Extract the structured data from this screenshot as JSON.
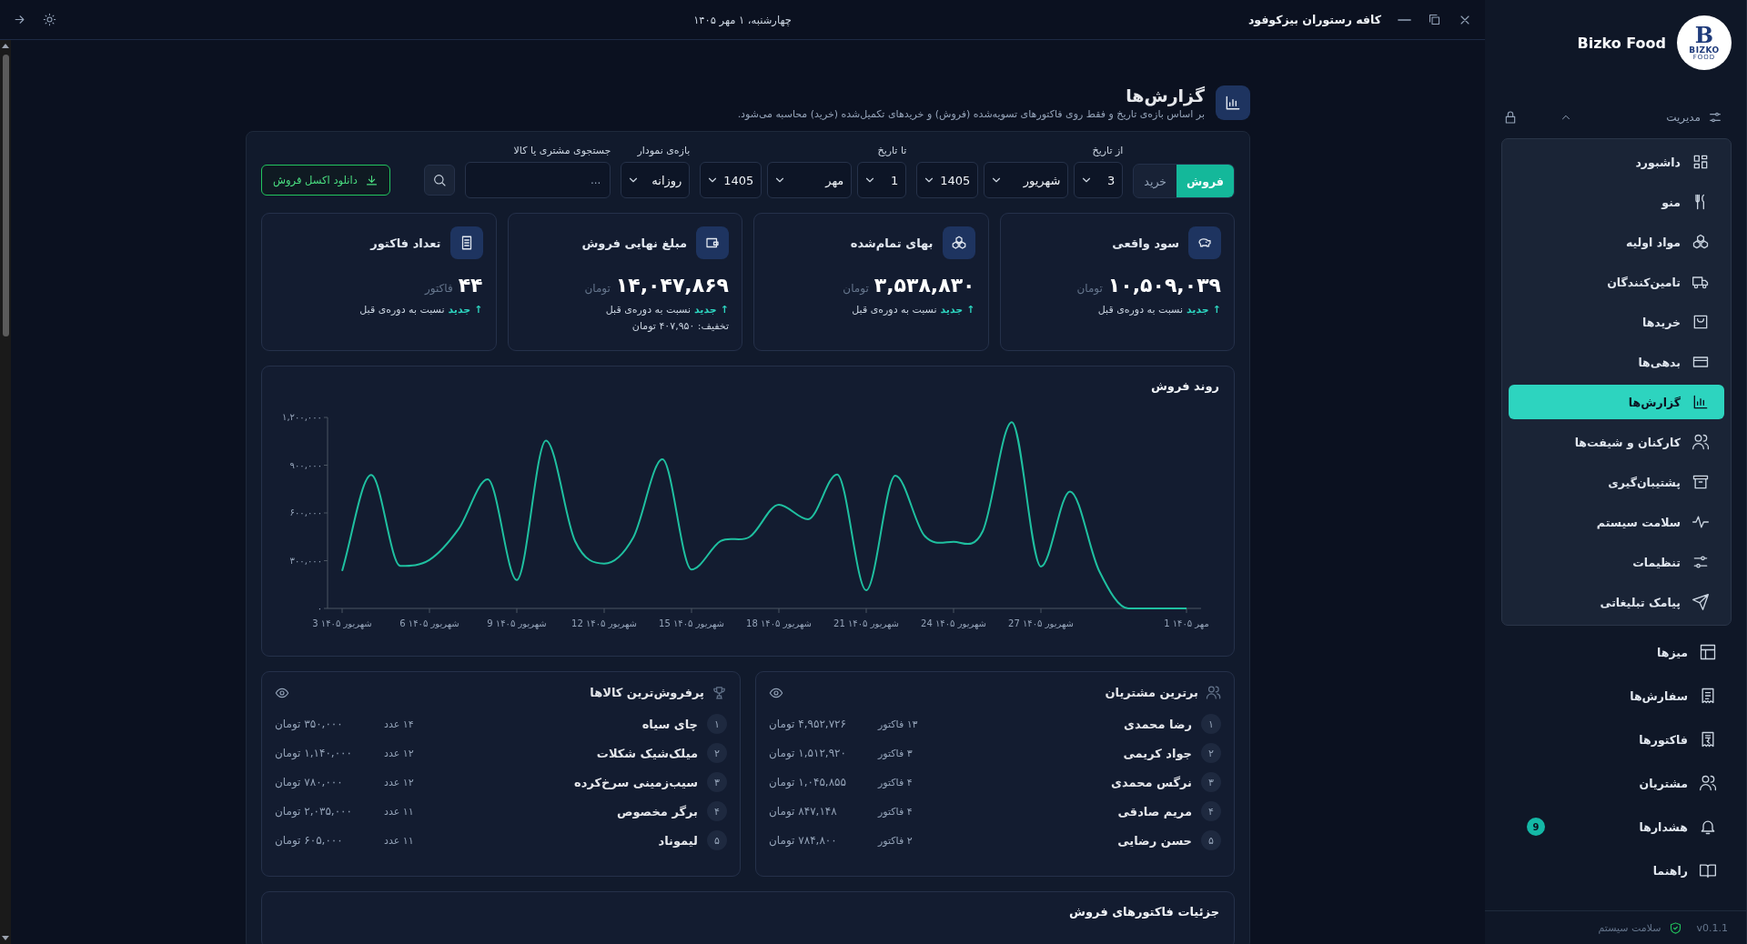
{
  "top_bar": {
    "date": "چهارشنبه، ۱ مهر ۱۴۰۵",
    "app_title": "کافه رستوران بیزکوفود"
  },
  "header": {
    "title": "گزارش‌ها",
    "subtitle": "بر اساس بازه‌ی تاریخ و فقط روی فاکتورهای تسویه‌شده (فروش) و خریدهای تکمیل‌شده (خرید) محاسبه می‌شود."
  },
  "filters": {
    "mode_toggle": [
      {
        "label": "فروش",
        "selected": true
      },
      {
        "label": "خرید",
        "selected": false
      }
    ],
    "groups": [
      {
        "label": "از تاریخ",
        "selects": [
          "3",
          "شهریور",
          "1405"
        ]
      },
      {
        "label": "تا تاریخ",
        "selects": [
          "1",
          "مهر",
          "1405"
        ]
      },
      {
        "label": "بازه‌ی نمودار",
        "selects": [
          "روزانه"
        ]
      }
    ],
    "search": {
      "label": "جستجوی مشتری یا کالا",
      "placeholder": "..."
    },
    "export_button": "دانلود اکسل فروش"
  },
  "stat_cards": [
    {
      "title": "سود واقعی",
      "value": "۱۰,۵۰۹,۰۳۹",
      "unit": "تومان",
      "trend": {
        "arrow": "↑",
        "badge": "جدید",
        "text": "نسبت به دوره‌ی قبل"
      }
    },
    {
      "title": "بهای تمام‌شده",
      "value": "۳,۵۳۸,۸۳۰",
      "unit": "تومان",
      "trend": {
        "arrow": "↑",
        "badge": "جدید",
        "text": "نسبت به دوره‌ی قبل"
      }
    },
    {
      "title": "مبلغ نهایی فروش",
      "value": "۱۴,۰۴۷,۸۶۹",
      "unit": "تومان",
      "trend": {
        "arrow": "↑",
        "badge": "جدید",
        "text": "نسبت به دوره‌ی قبل"
      },
      "note": "تخفیف: ۴۰۷,۹۵۰ تومان"
    },
    {
      "title": "تعداد فاکتور",
      "value": "۴۴",
      "unit": "فاکتور",
      "trend": {
        "arrow": "↑",
        "badge": "جدید",
        "text": "نسبت به دوره‌ی قبل"
      }
    }
  ],
  "sales_chart": {
    "title": "روند فروش",
    "chart_data": {
      "type": "line",
      "categories": [
        "3 شهریور ۱۴۰۵",
        null,
        null,
        "6 شهریور ۱۴۰۵",
        null,
        null,
        "9 شهریور ۱۴۰۵",
        null,
        null,
        "12 شهریور ۱۴۰۵",
        null,
        null,
        "15 شهریور ۱۴۰۵",
        null,
        null,
        "18 شهریور ۱۴۰۵",
        null,
        null,
        "21 شهریور ۱۴۰۵",
        null,
        null,
        "24 شهریور ۱۴۰۵",
        null,
        null,
        "27 شهریور ۱۴۰۵",
        null,
        null,
        null,
        null,
        "1 مهر ۱۴۰۵"
      ],
      "series": [
        {
          "color": "#1fc0a0",
          "values": [
            236000,
            838000,
            267000,
            305000,
            499000,
            811000,
            179000,
            1055000,
            423000,
            282000,
            446000,
            937000,
            244000,
            423000,
            450000,
            651000,
            560000,
            842000,
            114000,
            834000,
            457000,
            419000,
            484000,
            1170000,
            263000,
            735000,
            236000,
            0,
            0,
            0
          ]
        }
      ],
      "ylim": [
        0,
        1200000
      ],
      "yticks": [
        {
          "value": 0,
          "label": "۰"
        },
        {
          "value": 300000,
          "label": "۳۰۰,۰۰۰"
        },
        {
          "value": 600000,
          "label": "۶۰۰,۰۰۰"
        },
        {
          "value": 900000,
          "label": "۹۰۰,۰۰۰"
        },
        {
          "value": 1200000,
          "label": "۱,۲۰۰,۰۰۰"
        }
      ]
    }
  },
  "top_customers": {
    "title": "برترین مشتریان",
    "rows": [
      {
        "rank": "۱",
        "name": "رضا محمدی",
        "count": "۱۳ فاکتور",
        "amount": "۴,۹۵۲,۷۲۶ تومان"
      },
      {
        "rank": "۲",
        "name": "جواد کریمی",
        "count": "۳ فاکتور",
        "amount": "۱,۵۱۲,۹۲۰ تومان"
      },
      {
        "rank": "۳",
        "name": "نرگس محمدی",
        "count": "۴ فاکتور",
        "amount": "۱,۰۴۵,۸۵۵ تومان"
      },
      {
        "rank": "۴",
        "name": "مریم صادقی",
        "count": "۴ فاکتور",
        "amount": "۸۴۷,۱۴۸ تومان"
      },
      {
        "rank": "۵",
        "name": "حسن رضایی",
        "count": "۲ فاکتور",
        "amount": "۷۸۴,۸۰۰ تومان"
      }
    ]
  },
  "top_products": {
    "title": "پرفروش‌ترین کالاها",
    "rows": [
      {
        "rank": "۱",
        "name": "چای سیاه",
        "count": "۱۴ عدد",
        "amount": "۳۵۰,۰۰۰ تومان"
      },
      {
        "rank": "۲",
        "name": "میلک‌شیک شکلات",
        "count": "۱۲ عدد",
        "amount": "۱,۱۴۰,۰۰۰ تومان"
      },
      {
        "rank": "۳",
        "name": "سیب‌زمینی سرخ‌کرده",
        "count": "۱۲ عدد",
        "amount": "۷۸۰,۰۰۰ تومان"
      },
      {
        "rank": "۴",
        "name": "برگر مخصوص",
        "count": "۱۱ عدد",
        "amount": "۲,۰۳۵,۰۰۰ تومان"
      },
      {
        "rank": "۵",
        "name": "لیموناد",
        "count": "۱۱ عدد",
        "amount": "۶۰۵,۰۰۰ تومان"
      }
    ]
  },
  "invoice_details": {
    "title": "جزئیات فاکتورهای فروش"
  },
  "sidebar": {
    "brand": {
      "logo_letter": "B",
      "logo_word": "BIZKO",
      "logo_tagline": "FOOD",
      "name": "Bizko Food"
    },
    "group": {
      "label": "مدیریت",
      "expanded": true,
      "items": [
        {
          "label": "داشبورد",
          "selected": false
        },
        {
          "label": "منو",
          "selected": false
        },
        {
          "label": "مواد اولیه",
          "selected": false
        },
        {
          "label": "تامین‌کنندگان",
          "selected": false
        },
        {
          "label": "خریدها",
          "selected": false
        },
        {
          "label": "بدهی‌ها",
          "selected": false
        },
        {
          "label": "گزارش‌ها",
          "selected": true
        },
        {
          "label": "کارکنان و شیفت‌ها",
          "selected": false
        },
        {
          "label": "پشتیبان‌گیری",
          "selected": false
        },
        {
          "label": "سلامت سیستم",
          "selected": false
        },
        {
          "label": "تنظیمات",
          "selected": false
        },
        {
          "label": "پیامک تبلیغاتی",
          "selected": false
        }
      ]
    },
    "items": [
      {
        "label": "میزها",
        "selected": false
      },
      {
        "label": "سفارش‌ها",
        "selected": false
      },
      {
        "label": "فاکتورها",
        "selected": false
      },
      {
        "label": "مشتریان",
        "selected": false
      },
      {
        "label": "هشدارها",
        "selected": false,
        "badge": "9"
      },
      {
        "label": "راهنما",
        "selected": false
      }
    ],
    "footer": {
      "version": "v0.1.1",
      "status": "سلامت سیستم"
    }
  }
}
